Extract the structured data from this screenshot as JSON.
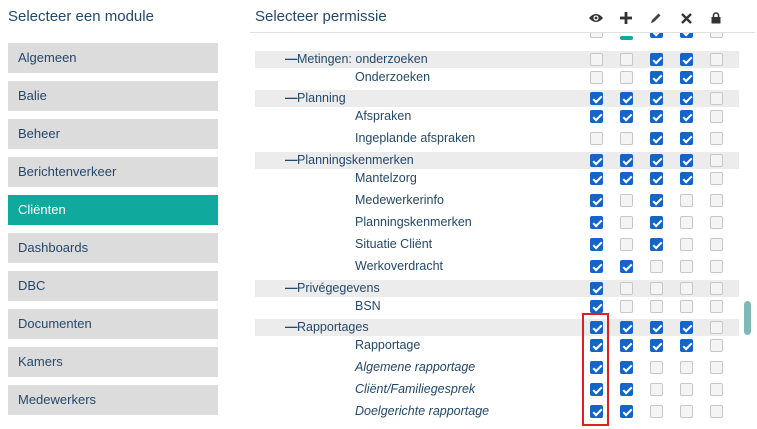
{
  "headers": {
    "modules_title": "Selecteer een module",
    "permissions_title": "Selecteer permissie"
  },
  "column_icons": [
    "eye-icon",
    "plus-icon",
    "pencil-icon",
    "cross-icon",
    "lock-icon"
  ],
  "colors": {
    "accent": "#0fa99e",
    "checkbox": "#1565c8",
    "highlight": "#e0201d"
  },
  "modules": [
    {
      "label": "Algemeen",
      "active": false
    },
    {
      "label": "Balie",
      "active": false
    },
    {
      "label": "Beheer",
      "active": false
    },
    {
      "label": "Berichtenverkeer",
      "active": false
    },
    {
      "label": "Cliënten",
      "active": true
    },
    {
      "label": "Dashboards",
      "active": false
    },
    {
      "label": "DBC",
      "active": false
    },
    {
      "label": "Documenten",
      "active": false
    },
    {
      "label": "Kamers",
      "active": false
    },
    {
      "label": "Medewerkers",
      "active": false
    }
  ],
  "permissions": [
    {
      "type": "group",
      "label": "Metingen: onderzoeken",
      "italic": false,
      "checks": [
        false,
        false,
        true,
        true,
        false
      ]
    },
    {
      "type": "child",
      "label": "Onderzoeken",
      "italic": false,
      "checks": [
        false,
        false,
        true,
        true,
        false
      ]
    },
    {
      "type": "group",
      "label": "Planning",
      "italic": false,
      "checks": [
        true,
        true,
        true,
        true,
        false
      ]
    },
    {
      "type": "child",
      "label": "Afspraken",
      "italic": false,
      "checks": [
        true,
        true,
        true,
        true,
        false
      ]
    },
    {
      "type": "child",
      "label": "Ingeplande afspraken",
      "italic": false,
      "checks": [
        false,
        false,
        true,
        true,
        false
      ]
    },
    {
      "type": "group",
      "label": "Planningskenmerken",
      "italic": false,
      "checks": [
        true,
        true,
        true,
        true,
        false
      ]
    },
    {
      "type": "child",
      "label": "Mantelzorg",
      "italic": false,
      "checks": [
        true,
        true,
        true,
        true,
        false
      ]
    },
    {
      "type": "child",
      "label": "Medewerkerinfo",
      "italic": false,
      "checks": [
        true,
        false,
        true,
        false,
        false
      ]
    },
    {
      "type": "child",
      "label": "Planningskenmerken",
      "italic": false,
      "checks": [
        true,
        false,
        true,
        false,
        false
      ]
    },
    {
      "type": "child",
      "label": "Situatie Cliënt",
      "italic": false,
      "checks": [
        true,
        false,
        true,
        false,
        false
      ]
    },
    {
      "type": "child",
      "label": "Werkoverdracht",
      "italic": false,
      "checks": [
        true,
        true,
        false,
        false,
        false
      ]
    },
    {
      "type": "group",
      "label": "Privégegevens",
      "italic": false,
      "checks": [
        true,
        false,
        false,
        false,
        false
      ]
    },
    {
      "type": "child",
      "label": "BSN",
      "italic": false,
      "checks": [
        true,
        false,
        false,
        false,
        false
      ]
    },
    {
      "type": "group",
      "label": "Rapportages",
      "italic": false,
      "checks": [
        true,
        true,
        true,
        true,
        false
      ]
    },
    {
      "type": "child",
      "label": "Rapportage",
      "italic": false,
      "checks": [
        true,
        true,
        true,
        true,
        false
      ]
    },
    {
      "type": "child",
      "label": "Algemene rapportage",
      "italic": true,
      "checks": [
        true,
        true,
        false,
        false,
        false
      ]
    },
    {
      "type": "child",
      "label": "Cliënt/Familiegesprek",
      "italic": true,
      "checks": [
        true,
        true,
        false,
        false,
        false
      ]
    },
    {
      "type": "child",
      "label": "Doelgerichte rapportage",
      "italic": true,
      "checks": [
        true,
        true,
        false,
        false,
        false
      ]
    }
  ]
}
